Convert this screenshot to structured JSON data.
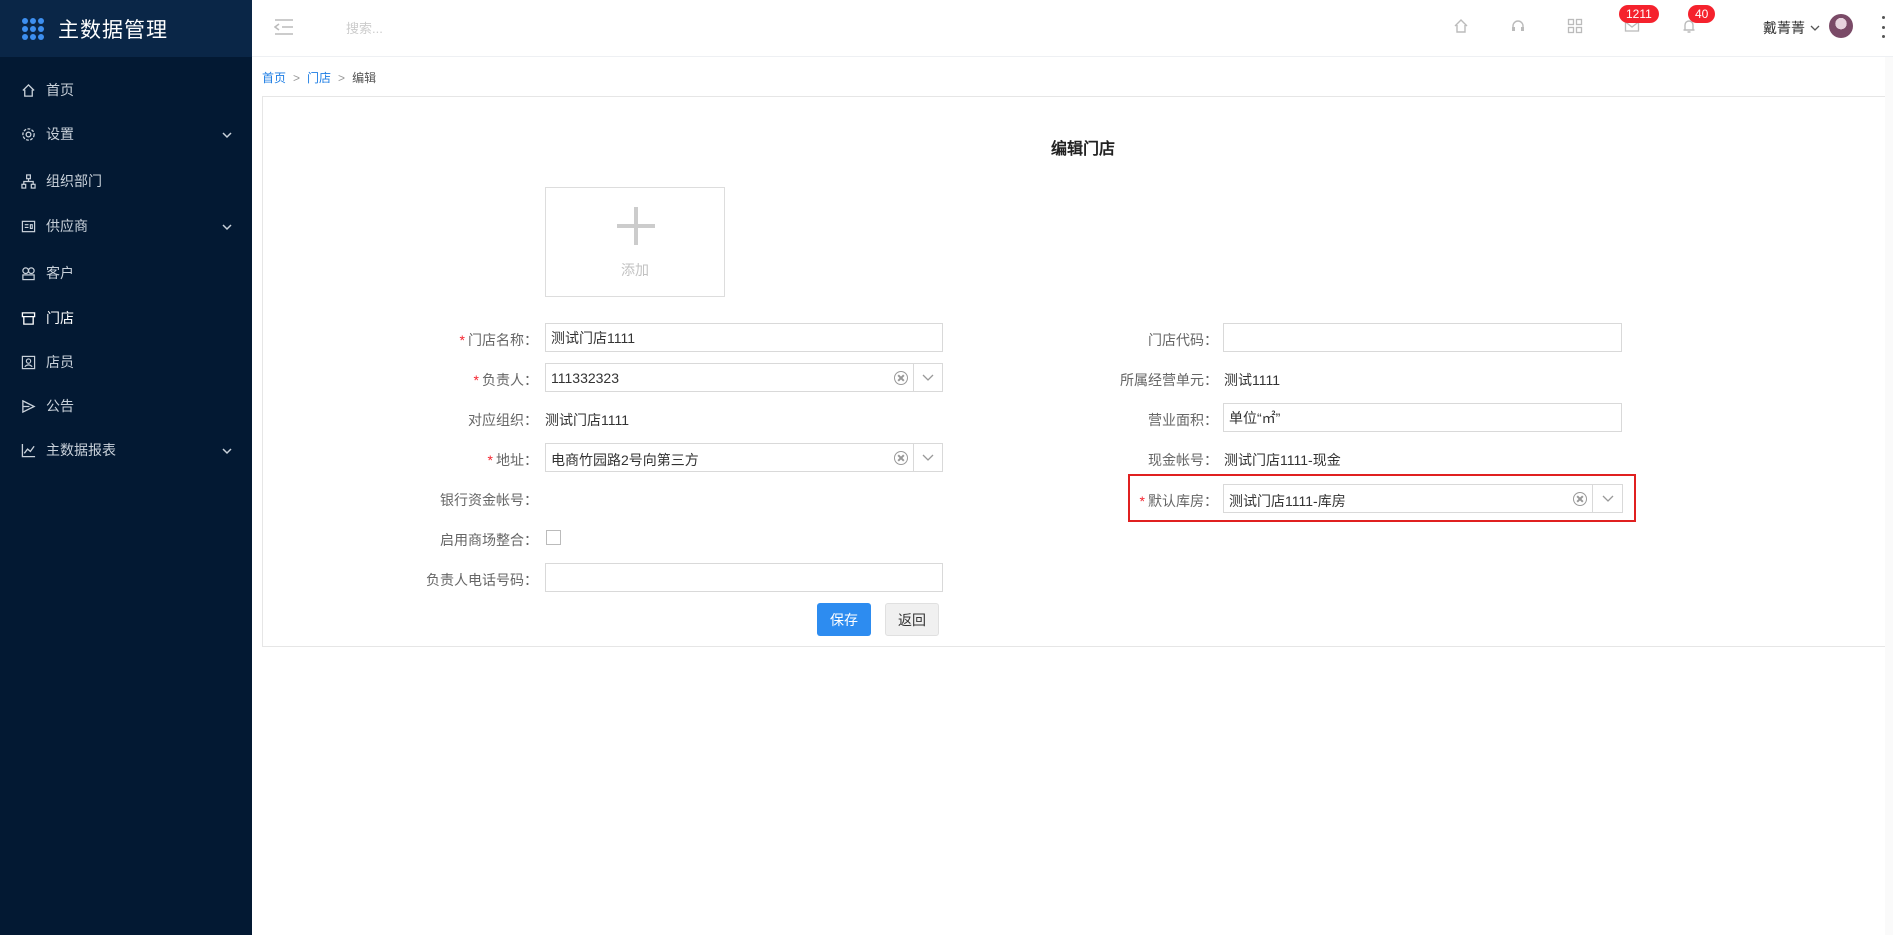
{
  "app": {
    "title": "主数据管理"
  },
  "sidebar": {
    "items": [
      {
        "label": "首页",
        "icon": "home-icon",
        "has_children": false,
        "active": false
      },
      {
        "label": "设置",
        "icon": "gear-icon",
        "has_children": true,
        "active": false
      },
      {
        "label": "组织部门",
        "icon": "org-tree-icon",
        "has_children": false,
        "active": false
      },
      {
        "label": "供应商",
        "icon": "supplier-icon",
        "has_children": true,
        "active": false
      },
      {
        "label": "客户",
        "icon": "customer-icon",
        "has_children": false,
        "active": false
      },
      {
        "label": "门店",
        "icon": "store-icon",
        "has_children": false,
        "active": true
      },
      {
        "label": "店员",
        "icon": "staff-icon",
        "has_children": false,
        "active": false
      },
      {
        "label": "公告",
        "icon": "announcement-icon",
        "has_children": false,
        "active": false
      },
      {
        "label": "主数据报表",
        "icon": "chart-icon",
        "has_children": true,
        "active": false
      }
    ]
  },
  "header": {
    "search_placeholder": "搜索...",
    "badges": {
      "messages": "1211",
      "notifications": "40"
    },
    "user_name": "戴菁菁"
  },
  "breadcrumb": {
    "home": "首页",
    "section": "门店",
    "current": "编辑",
    "separator": ">"
  },
  "form": {
    "title": "编辑门店",
    "upload_label": "添加",
    "required_mark": "*",
    "store_name": {
      "label": "门店名称：",
      "value": "测试门店1111"
    },
    "owner": {
      "label": "负责人：",
      "value": "111332323"
    },
    "org": {
      "label": "对应组织：",
      "value": "测试门店1111"
    },
    "address": {
      "label": "地址：",
      "value": "电商竹园路2号向第三方"
    },
    "bank_account": {
      "label": "银行资金帐号：",
      "value": ""
    },
    "mall_integration": {
      "label": "启用商场整合：",
      "checked": false
    },
    "owner_phone": {
      "label": "负责人电话号码：",
      "value": ""
    },
    "store_code": {
      "label": "门店代码：",
      "value": ""
    },
    "business_unit": {
      "label": "所属经营单元：",
      "value": "测试1111"
    },
    "area": {
      "label": "营业面积：",
      "value": "单位“㎡”"
    },
    "cash_account": {
      "label": "现金帐号：",
      "value": "测试门店1111-现金"
    },
    "warehouse": {
      "label": "默认库房：",
      "value": "测试门店1111-库房"
    },
    "save_label": "保存",
    "back_label": "返回"
  },
  "colors": {
    "sidebar_bg": "#031933",
    "brand_bg": "#0a2647",
    "primary": "#2d8cf0",
    "link": "#1e7ee4",
    "badge": "#f5222d",
    "highlight": "#e02020"
  }
}
